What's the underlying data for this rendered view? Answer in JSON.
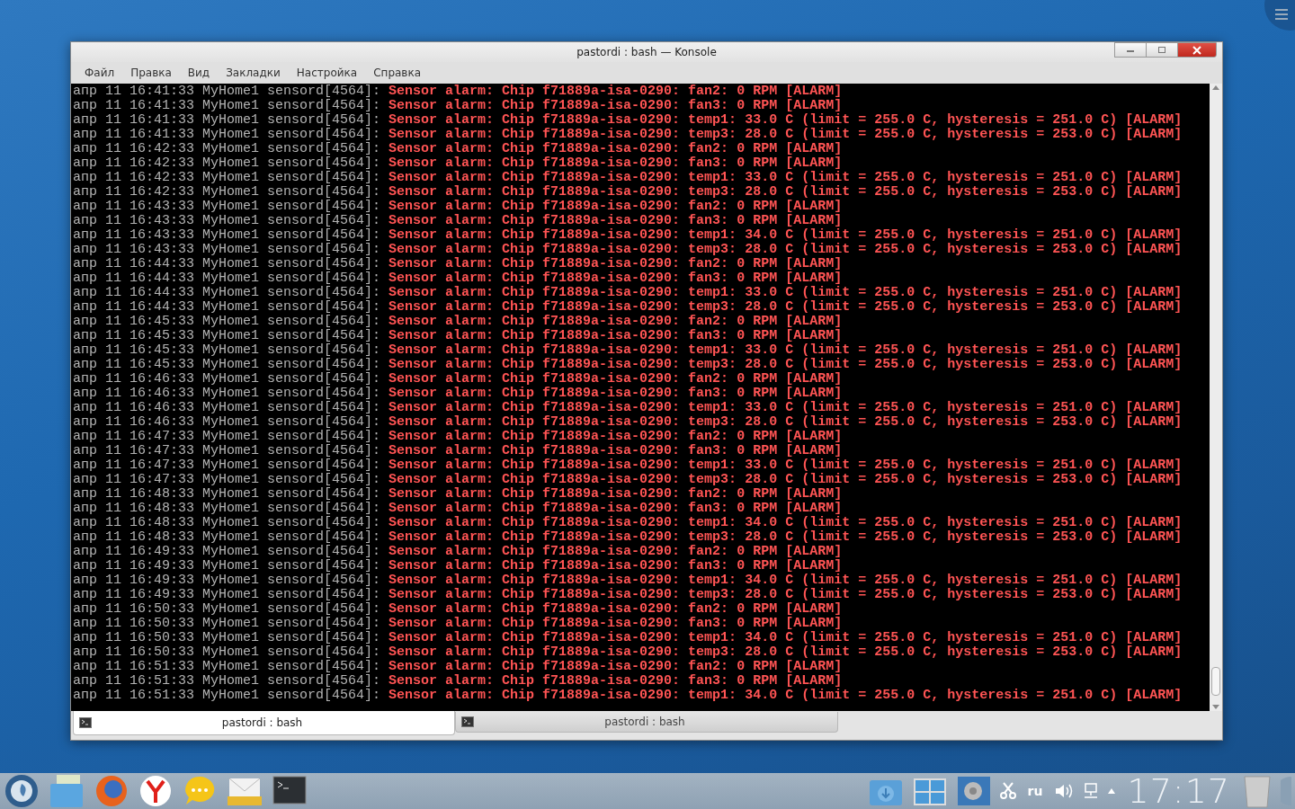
{
  "window": {
    "title": "pastordi : bash — Konsole"
  },
  "menu": [
    "Файл",
    "Правка",
    "Вид",
    "Закладки",
    "Настройка",
    "Справка"
  ],
  "terminal": {
    "lines": [
      {
        "prefix": "апр 11 16:41:33 MyHome1 sensord[4564]:",
        "message": "Sensor alarm: Chip f71889a-isa-0290: fan2: 0 RPM [ALARM]"
      },
      {
        "prefix": "апр 11 16:41:33 MyHome1 sensord[4564]:",
        "message": "Sensor alarm: Chip f71889a-isa-0290: fan3: 0 RPM [ALARM]"
      },
      {
        "prefix": "апр 11 16:41:33 MyHome1 sensord[4564]:",
        "message": "Sensor alarm: Chip f71889a-isa-0290: temp1: 33.0 C (limit = 255.0 C, hysteresis = 251.0 C) [ALARM]"
      },
      {
        "prefix": "апр 11 16:41:33 MyHome1 sensord[4564]:",
        "message": "Sensor alarm: Chip f71889a-isa-0290: temp3: 28.0 C (limit = 255.0 C, hysteresis = 253.0 C) [ALARM]"
      },
      {
        "prefix": "апр 11 16:42:33 MyHome1 sensord[4564]:",
        "message": "Sensor alarm: Chip f71889a-isa-0290: fan2: 0 RPM [ALARM]"
      },
      {
        "prefix": "апр 11 16:42:33 MyHome1 sensord[4564]:",
        "message": "Sensor alarm: Chip f71889a-isa-0290: fan3: 0 RPM [ALARM]"
      },
      {
        "prefix": "апр 11 16:42:33 MyHome1 sensord[4564]:",
        "message": "Sensor alarm: Chip f71889a-isa-0290: temp1: 33.0 C (limit = 255.0 C, hysteresis = 251.0 C) [ALARM]"
      },
      {
        "prefix": "апр 11 16:42:33 MyHome1 sensord[4564]:",
        "message": "Sensor alarm: Chip f71889a-isa-0290: temp3: 28.0 C (limit = 255.0 C, hysteresis = 253.0 C) [ALARM]"
      },
      {
        "prefix": "апр 11 16:43:33 MyHome1 sensord[4564]:",
        "message": "Sensor alarm: Chip f71889a-isa-0290: fan2: 0 RPM [ALARM]"
      },
      {
        "prefix": "апр 11 16:43:33 MyHome1 sensord[4564]:",
        "message": "Sensor alarm: Chip f71889a-isa-0290: fan3: 0 RPM [ALARM]"
      },
      {
        "prefix": "апр 11 16:43:33 MyHome1 sensord[4564]:",
        "message": "Sensor alarm: Chip f71889a-isa-0290: temp1: 34.0 C (limit = 255.0 C, hysteresis = 251.0 C) [ALARM]"
      },
      {
        "prefix": "апр 11 16:43:33 MyHome1 sensord[4564]:",
        "message": "Sensor alarm: Chip f71889a-isa-0290: temp3: 28.0 C (limit = 255.0 C, hysteresis = 253.0 C) [ALARM]"
      },
      {
        "prefix": "апр 11 16:44:33 MyHome1 sensord[4564]:",
        "message": "Sensor alarm: Chip f71889a-isa-0290: fan2: 0 RPM [ALARM]"
      },
      {
        "prefix": "апр 11 16:44:33 MyHome1 sensord[4564]:",
        "message": "Sensor alarm: Chip f71889a-isa-0290: fan3: 0 RPM [ALARM]"
      },
      {
        "prefix": "апр 11 16:44:33 MyHome1 sensord[4564]:",
        "message": "Sensor alarm: Chip f71889a-isa-0290: temp1: 33.0 C (limit = 255.0 C, hysteresis = 251.0 C) [ALARM]"
      },
      {
        "prefix": "апр 11 16:44:33 MyHome1 sensord[4564]:",
        "message": "Sensor alarm: Chip f71889a-isa-0290: temp3: 28.0 C (limit = 255.0 C, hysteresis = 253.0 C) [ALARM]"
      },
      {
        "prefix": "апр 11 16:45:33 MyHome1 sensord[4564]:",
        "message": "Sensor alarm: Chip f71889a-isa-0290: fan2: 0 RPM [ALARM]"
      },
      {
        "prefix": "апр 11 16:45:33 MyHome1 sensord[4564]:",
        "message": "Sensor alarm: Chip f71889a-isa-0290: fan3: 0 RPM [ALARM]"
      },
      {
        "prefix": "апр 11 16:45:33 MyHome1 sensord[4564]:",
        "message": "Sensor alarm: Chip f71889a-isa-0290: temp1: 33.0 C (limit = 255.0 C, hysteresis = 251.0 C) [ALARM]"
      },
      {
        "prefix": "апр 11 16:45:33 MyHome1 sensord[4564]:",
        "message": "Sensor alarm: Chip f71889a-isa-0290: temp3: 28.0 C (limit = 255.0 C, hysteresis = 253.0 C) [ALARM]"
      },
      {
        "prefix": "апр 11 16:46:33 MyHome1 sensord[4564]:",
        "message": "Sensor alarm: Chip f71889a-isa-0290: fan2: 0 RPM [ALARM]"
      },
      {
        "prefix": "апр 11 16:46:33 MyHome1 sensord[4564]:",
        "message": "Sensor alarm: Chip f71889a-isa-0290: fan3: 0 RPM [ALARM]"
      },
      {
        "prefix": "апр 11 16:46:33 MyHome1 sensord[4564]:",
        "message": "Sensor alarm: Chip f71889a-isa-0290: temp1: 33.0 C (limit = 255.0 C, hysteresis = 251.0 C) [ALARM]"
      },
      {
        "prefix": "апр 11 16:46:33 MyHome1 sensord[4564]:",
        "message": "Sensor alarm: Chip f71889a-isa-0290: temp3: 28.0 C (limit = 255.0 C, hysteresis = 253.0 C) [ALARM]"
      },
      {
        "prefix": "апр 11 16:47:33 MyHome1 sensord[4564]:",
        "message": "Sensor alarm: Chip f71889a-isa-0290: fan2: 0 RPM [ALARM]"
      },
      {
        "prefix": "апр 11 16:47:33 MyHome1 sensord[4564]:",
        "message": "Sensor alarm: Chip f71889a-isa-0290: fan3: 0 RPM [ALARM]"
      },
      {
        "prefix": "апр 11 16:47:33 MyHome1 sensord[4564]:",
        "message": "Sensor alarm: Chip f71889a-isa-0290: temp1: 33.0 C (limit = 255.0 C, hysteresis = 251.0 C) [ALARM]"
      },
      {
        "prefix": "апр 11 16:47:33 MyHome1 sensord[4564]:",
        "message": "Sensor alarm: Chip f71889a-isa-0290: temp3: 28.0 C (limit = 255.0 C, hysteresis = 253.0 C) [ALARM]"
      },
      {
        "prefix": "апр 11 16:48:33 MyHome1 sensord[4564]:",
        "message": "Sensor alarm: Chip f71889a-isa-0290: fan2: 0 RPM [ALARM]"
      },
      {
        "prefix": "апр 11 16:48:33 MyHome1 sensord[4564]:",
        "message": "Sensor alarm: Chip f71889a-isa-0290: fan3: 0 RPM [ALARM]"
      },
      {
        "prefix": "апр 11 16:48:33 MyHome1 sensord[4564]:",
        "message": "Sensor alarm: Chip f71889a-isa-0290: temp1: 34.0 C (limit = 255.0 C, hysteresis = 251.0 C) [ALARM]"
      },
      {
        "prefix": "апр 11 16:48:33 MyHome1 sensord[4564]:",
        "message": "Sensor alarm: Chip f71889a-isa-0290: temp3: 28.0 C (limit = 255.0 C, hysteresis = 253.0 C) [ALARM]"
      },
      {
        "prefix": "апр 11 16:49:33 MyHome1 sensord[4564]:",
        "message": "Sensor alarm: Chip f71889a-isa-0290: fan2: 0 RPM [ALARM]"
      },
      {
        "prefix": "апр 11 16:49:33 MyHome1 sensord[4564]:",
        "message": "Sensor alarm: Chip f71889a-isa-0290: fan3: 0 RPM [ALARM]"
      },
      {
        "prefix": "апр 11 16:49:33 MyHome1 sensord[4564]:",
        "message": "Sensor alarm: Chip f71889a-isa-0290: temp1: 34.0 C (limit = 255.0 C, hysteresis = 251.0 C) [ALARM]"
      },
      {
        "prefix": "апр 11 16:49:33 MyHome1 sensord[4564]:",
        "message": "Sensor alarm: Chip f71889a-isa-0290: temp3: 28.0 C (limit = 255.0 C, hysteresis = 253.0 C) [ALARM]"
      },
      {
        "prefix": "апр 11 16:50:33 MyHome1 sensord[4564]:",
        "message": "Sensor alarm: Chip f71889a-isa-0290: fan2: 0 RPM [ALARM]"
      },
      {
        "prefix": "апр 11 16:50:33 MyHome1 sensord[4564]:",
        "message": "Sensor alarm: Chip f71889a-isa-0290: fan3: 0 RPM [ALARM]"
      },
      {
        "prefix": "апр 11 16:50:33 MyHome1 sensord[4564]:",
        "message": "Sensor alarm: Chip f71889a-isa-0290: temp1: 34.0 C (limit = 255.0 C, hysteresis = 251.0 C) [ALARM]"
      },
      {
        "prefix": "апр 11 16:50:33 MyHome1 sensord[4564]:",
        "message": "Sensor alarm: Chip f71889a-isa-0290: temp3: 28.0 C (limit = 255.0 C, hysteresis = 253.0 C) [ALARM]"
      },
      {
        "prefix": "апр 11 16:51:33 MyHome1 sensord[4564]:",
        "message": "Sensor alarm: Chip f71889a-isa-0290: fan2: 0 RPM [ALARM]"
      },
      {
        "prefix": "апр 11 16:51:33 MyHome1 sensord[4564]:",
        "message": "Sensor alarm: Chip f71889a-isa-0290: fan3: 0 RPM [ALARM]"
      },
      {
        "prefix": "апр 11 16:51:33 MyHome1 sensord[4564]:",
        "message": "Sensor alarm: Chip f71889a-isa-0290: temp1: 34.0 C (limit = 255.0 C, hysteresis = 251.0 C) [ALARM]"
      }
    ]
  },
  "tabs": [
    {
      "label": "pastordi : bash",
      "selected": true
    },
    {
      "label": "pastordi : bash",
      "selected": false
    }
  ],
  "tray": {
    "keyboard_layout": "ru",
    "clock": "17:17"
  }
}
